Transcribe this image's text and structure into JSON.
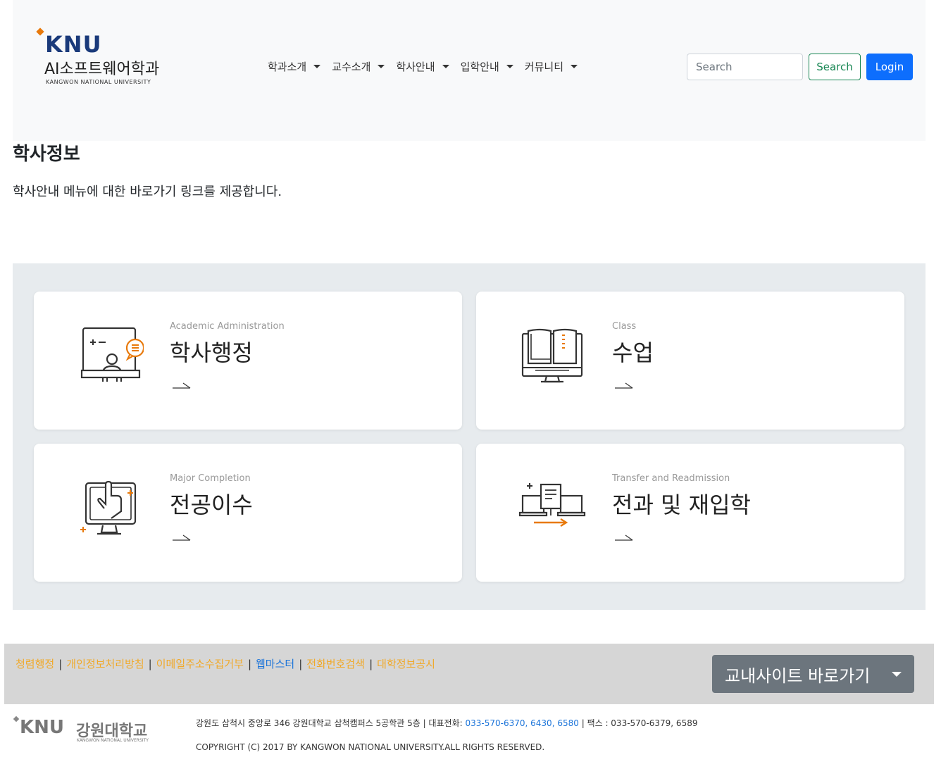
{
  "header": {
    "logo_knu": "KNU",
    "logo_dept": "AI소프트웨어학과",
    "logo_univ": "KANGWON NATIONAL UNIVERSITY",
    "nav": [
      "학과소개",
      "교수소개",
      "학사안내",
      "입학안내",
      "커뮤니티"
    ],
    "search_placeholder": "Search",
    "search_label": "Search",
    "login_label": "Login"
  },
  "page": {
    "title": "학사정보",
    "description": "학사안내 메뉴에 대한 바로가기 링크를 제공합니다."
  },
  "cards": [
    {
      "subtitle": "Academic Administration",
      "title": "학사행정",
      "icon": "presentation-icon"
    },
    {
      "subtitle": "Class",
      "title": "수업",
      "icon": "book-monitor-icon"
    },
    {
      "subtitle": "Major Completion",
      "title": "전공이수",
      "icon": "touch-screen-icon"
    },
    {
      "subtitle": "Transfer and Readmission",
      "title": "전과 및 재입학",
      "icon": "transfer-laptops-icon"
    }
  ],
  "footer": {
    "links": [
      "청렴행정",
      "개인정보처리방침",
      "이메일주소수집거부",
      "웹마스터",
      "전화번호검색",
      "대학정보공시"
    ],
    "site_button": "교내사이트 바로가기",
    "logo_knu": "KNU",
    "logo_kor": "강원대학교",
    "logo_en": "KANGWON NATIONAL UNIVERSITY",
    "address_prefix": "강원도 삼척시 중앙로 346 강원대학교 삼척캠퍼스 5공학관 5층 | 대표전화:",
    "phone": "033-570-6370, 6430, 6580",
    "fax": "| 팩스 : 033-570-6379, 6589",
    "copyright": "COPYRIGHT (C) 2017 BY KANGWON NATIONAL UNIVERSITY.ALL RIGHTS RESERVED."
  },
  "colors": {
    "accent_orange": "#e8790a",
    "primary_blue": "#0d6efd",
    "success_green": "#198754"
  }
}
